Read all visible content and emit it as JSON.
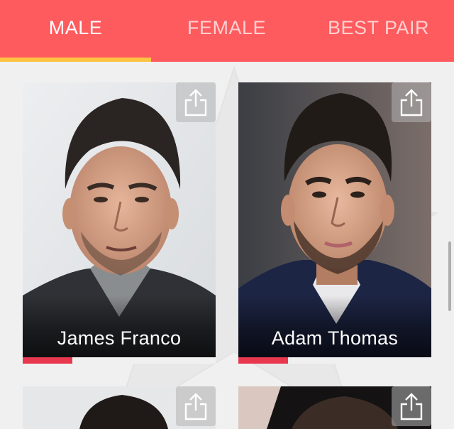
{
  "tabs": [
    {
      "label": "MALE",
      "active": true
    },
    {
      "label": "FEMALE",
      "active": false
    },
    {
      "label": "BEST PAIR",
      "active": false
    }
  ],
  "colors": {
    "tabbar": "#fe5b5e",
    "tab_indicator": "#fcc342",
    "progress": "#e8384f",
    "background": "#f0f0f0"
  },
  "cards": [
    {
      "name": "James Franco",
      "progress_fraction": 0.26
    },
    {
      "name": "Adam Thomas",
      "progress_fraction": 0.26
    },
    {
      "name": "",
      "progress_fraction": null
    },
    {
      "name": "",
      "progress_fraction": null
    }
  ],
  "icons": {
    "share": "share-icon"
  }
}
